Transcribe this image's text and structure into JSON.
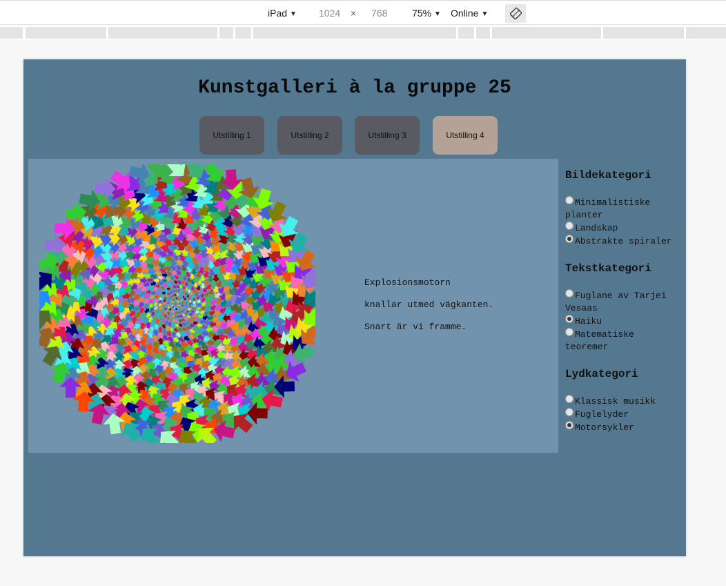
{
  "devtools": {
    "device": "iPad",
    "width": "1024",
    "times": "×",
    "height": "768",
    "zoom": "75%",
    "network": "Online",
    "dropdown_arrow": "▼"
  },
  "site": {
    "title": "Kunstgalleri à la gruppe 25",
    "tabs": [
      {
        "label": "Utstilling 1",
        "active": false
      },
      {
        "label": "Utstilling 2",
        "active": false
      },
      {
        "label": "Utstilling 3",
        "active": false
      },
      {
        "label": "Utstilling 4",
        "active": true
      }
    ]
  },
  "poem": {
    "lines": [
      "Explosionsmotorn",
      "knallar utmed vägkanten.",
      "Snart är vi framme."
    ]
  },
  "sidebar": {
    "image_category": {
      "title": "Bildekategori",
      "options": [
        {
          "label": "Minimalistiske planter",
          "checked": false
        },
        {
          "label": "Landskap",
          "checked": false
        },
        {
          "label": "Abstrakte spiraler",
          "checked": true
        }
      ]
    },
    "text_category": {
      "title": "Tekstkategori",
      "options": [
        {
          "label": "Fuglane av Tarjei Vesaas",
          "checked": false
        },
        {
          "label": "Haiku",
          "checked": true
        },
        {
          "label": "Matematiske teoremer",
          "checked": false
        }
      ]
    },
    "sound_category": {
      "title": "Lydkategori",
      "options": [
        {
          "label": "Klassisk musikk",
          "checked": false
        },
        {
          "label": "Fuglelyder",
          "checked": false
        },
        {
          "label": "Motorsykler",
          "checked": true
        }
      ]
    }
  },
  "colors": {
    "page_bg": "#557891",
    "exhibit_bg": "#7293ad",
    "tab_bg": "#5a5a62",
    "tab_active_bg": "#b3a295"
  },
  "artwork": {
    "icon": "arrow-spiral-sphere"
  }
}
